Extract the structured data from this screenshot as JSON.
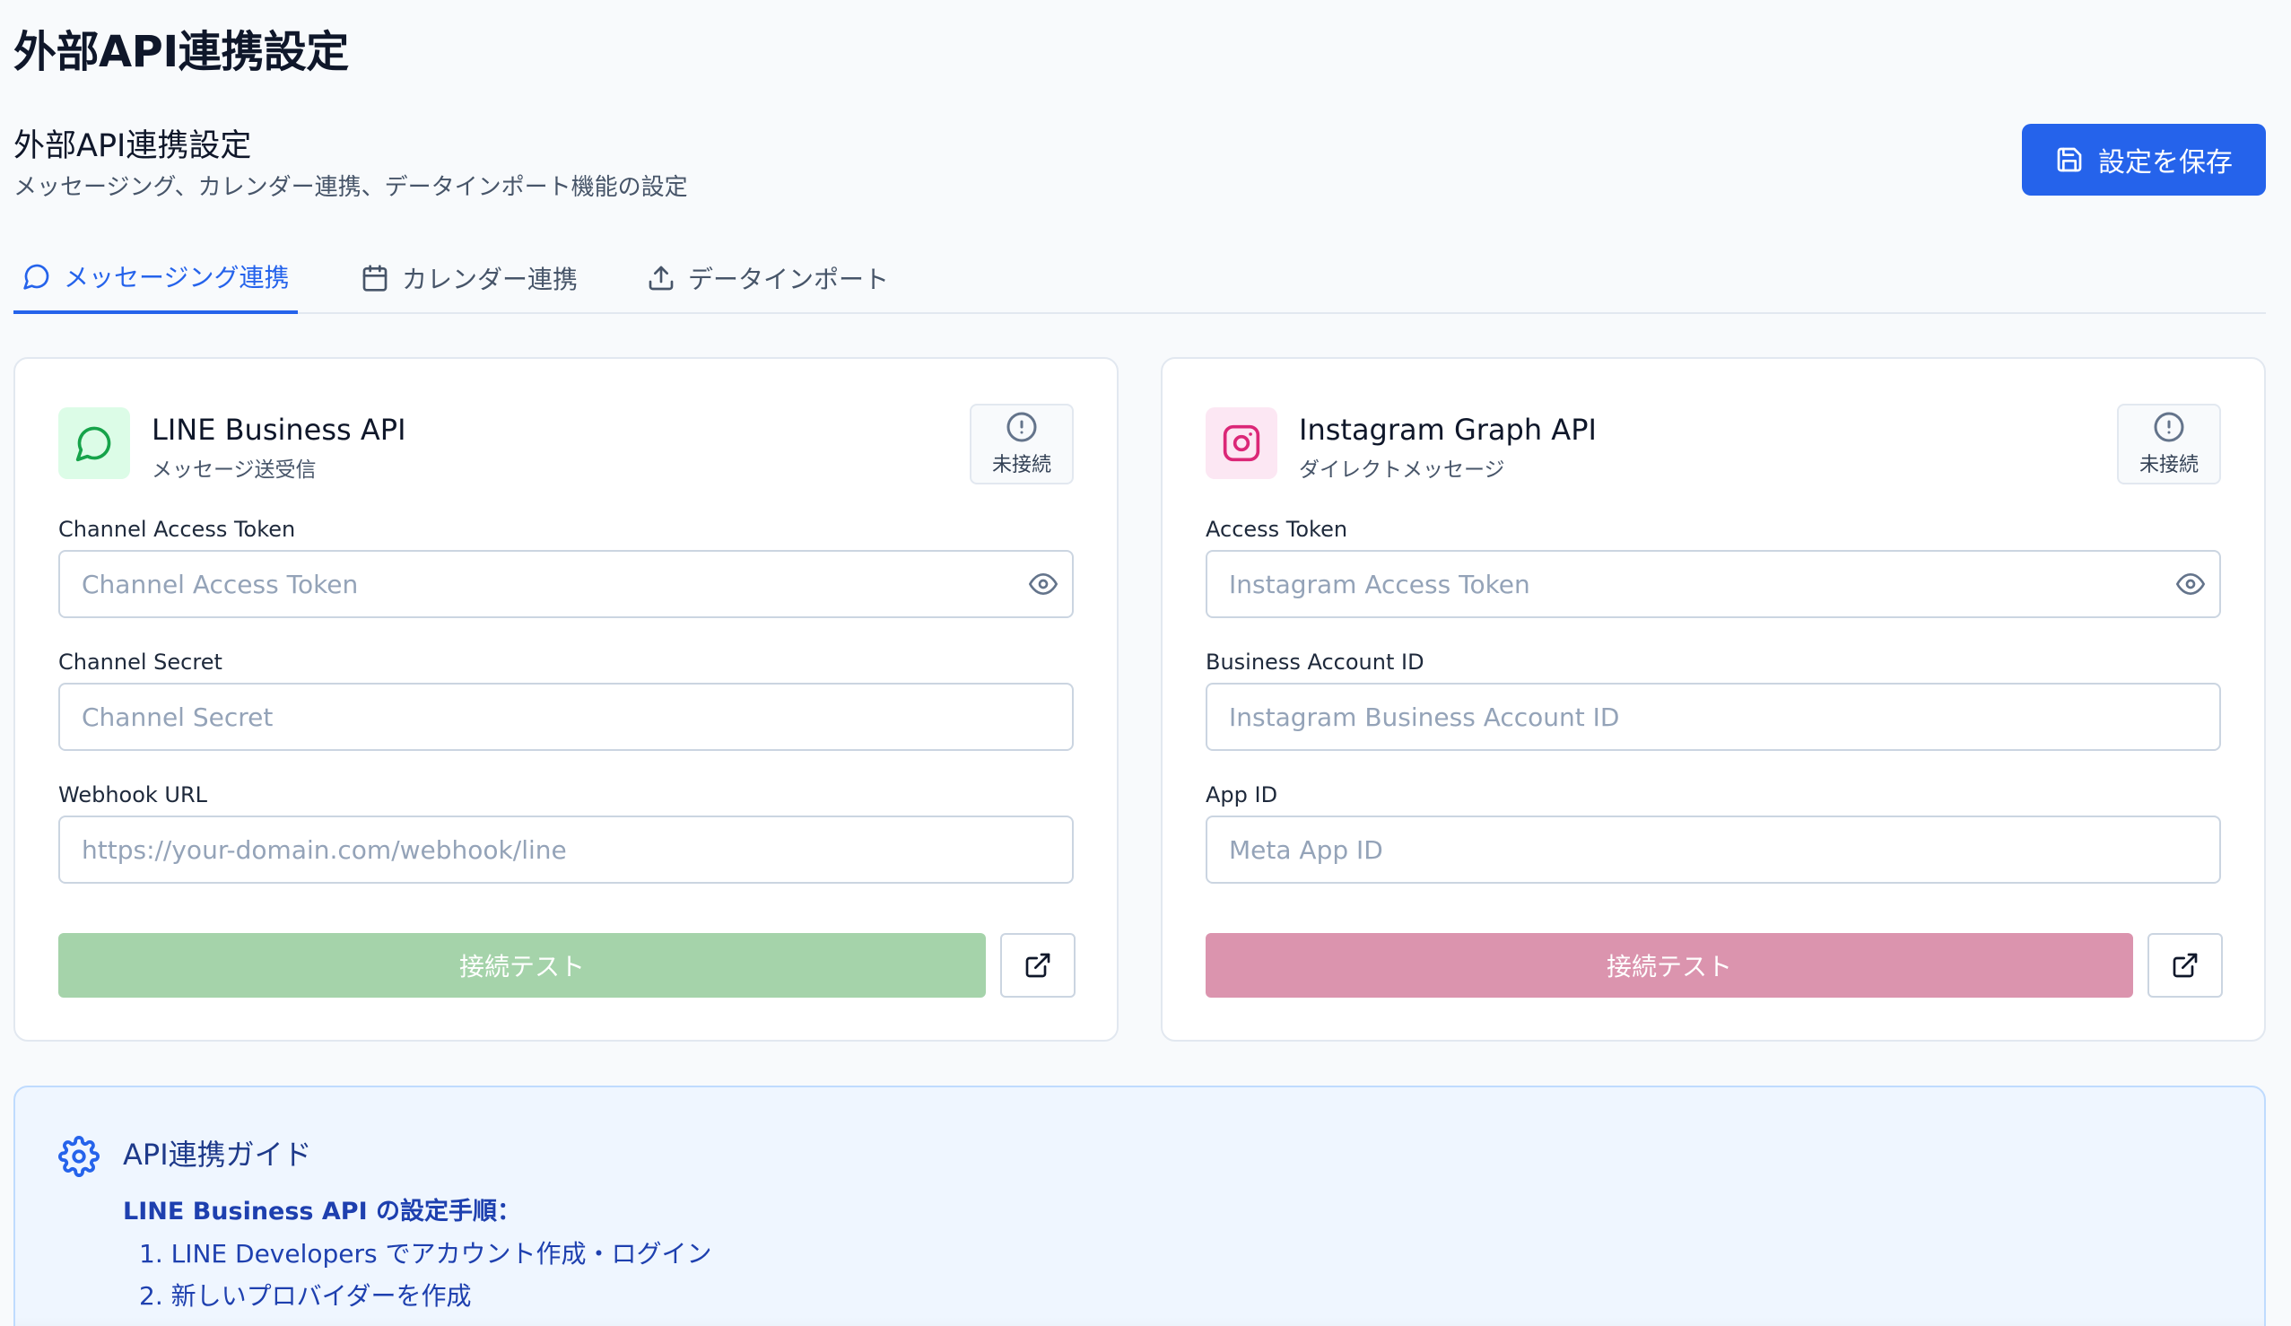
{
  "page": {
    "title": "外部API連携設定",
    "section_title": "外部API連携設定",
    "section_desc": "メッセージング、カレンダー連携、データインポート機能の設定",
    "save_label": "設定を保存"
  },
  "tabs": [
    {
      "label": "メッセージング連携",
      "icon": "message-circle-icon",
      "active": true
    },
    {
      "label": "カレンダー連携",
      "icon": "calendar-icon",
      "active": false
    },
    {
      "label": "データインポート",
      "icon": "upload-icon",
      "active": false
    }
  ],
  "line": {
    "title": "LINE Business API",
    "subtitle": "メッセージ送受信",
    "status": "未接続",
    "fields": [
      {
        "label": "Channel Access Token",
        "placeholder": "Channel Access Token",
        "value": ""
      },
      {
        "label": "Channel Secret",
        "placeholder": "Channel Secret",
        "value": ""
      },
      {
        "label": "Webhook URL",
        "placeholder": "https://your-domain.com/webhook/line",
        "value": ""
      }
    ],
    "test_label": "接続テスト",
    "accent": "#16a34a",
    "icon_bg": "#dcfce7",
    "button_color": "#a5d3aa"
  },
  "instagram": {
    "title": "Instagram Graph API",
    "subtitle": "ダイレクトメッセージ",
    "status": "未接続",
    "fields": [
      {
        "label": "Access Token",
        "placeholder": "Instagram Access Token",
        "value": ""
      },
      {
        "label": "Business Account ID",
        "placeholder": "Instagram Business Account ID",
        "value": ""
      },
      {
        "label": "App ID",
        "placeholder": "Meta App ID",
        "value": ""
      }
    ],
    "test_label": "接続テスト",
    "accent": "#db2777",
    "icon_bg": "#fce7f3",
    "button_color": "#db94ae"
  },
  "guide": {
    "title": "API連携ガイド",
    "subtitle": "LINE Business API の設定手順：",
    "steps": [
      "1. LINE Developers でアカウント作成・ログイン",
      "2. 新しいプロバイダーを作成"
    ]
  }
}
